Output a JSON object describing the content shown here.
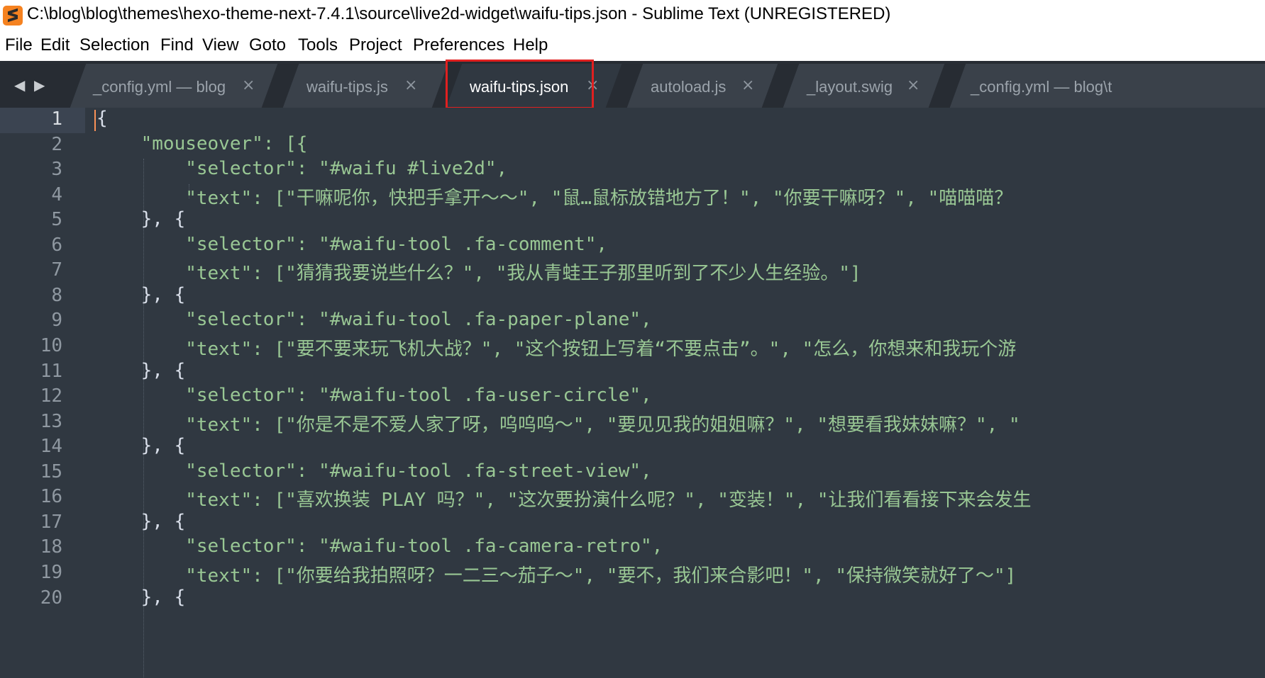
{
  "window": {
    "title": "C:\\blog\\blog\\themes\\hexo-theme-next-7.4.1\\source\\live2d-widget\\waifu-tips.json - Sublime Text (UNREGISTERED)"
  },
  "menu": [
    "File",
    "Edit",
    "Selection",
    "Find",
    "View",
    "Goto",
    "Tools",
    "Project",
    "Preferences",
    "Help"
  ],
  "tabs": [
    {
      "label": "_config.yml — blog",
      "close": "×",
      "active": false
    },
    {
      "label": "waifu-tips.js",
      "close": "×",
      "active": false
    },
    {
      "label": "waifu-tips.json",
      "close": "×",
      "active": true
    },
    {
      "label": "autoload.js",
      "close": "×",
      "active": false
    },
    {
      "label": "_layout.swig",
      "close": "×",
      "active": false
    },
    {
      "label": "_config.yml — blog\\t",
      "close": "",
      "active": false
    }
  ],
  "nav": {
    "back": "◀",
    "forward": "▶"
  },
  "editor": {
    "line_numbers": [
      "1",
      "2",
      "3",
      "4",
      "5",
      "6",
      "7",
      "8",
      "9",
      "10",
      "11",
      "12",
      "13",
      "14",
      "15",
      "16",
      "17",
      "18",
      "19",
      "20"
    ],
    "lines": [
      "{",
      "    \"mouseover\": [{",
      "        \"selector\": \"#waifu #live2d\",",
      "        \"text\": [\"干嘛呢你，快把手拿开～～\", \"鼠…鼠标放错地方了！\", \"你要干嘛呀？\", \"喵喵喵？",
      "    }, {",
      "        \"selector\": \"#waifu-tool .fa-comment\",",
      "        \"text\": [\"猜猜我要说些什么？\", \"我从青蛙王子那里听到了不少人生经验。\"]",
      "    }, {",
      "        \"selector\": \"#waifu-tool .fa-paper-plane\",",
      "        \"text\": [\"要不要来玩飞机大战？\", \"这个按钮上写着“不要点击”。\", \"怎么，你想来和我玩个游",
      "    }, {",
      "        \"selector\": \"#waifu-tool .fa-user-circle\",",
      "        \"text\": [\"你是不是不爱人家了呀，呜呜呜～\", \"要见见我的姐姐嘛？\", \"想要看我妹妹嘛？\", \"",
      "    }, {",
      "        \"selector\": \"#waifu-tool .fa-street-view\",",
      "        \"text\": [\"喜欢换装 PLAY 吗？\", \"这次要扮演什么呢？\", \"变装！\", \"让我们看看接下来会发生",
      "    }, {",
      "        \"selector\": \"#waifu-tool .fa-camera-retro\",",
      "        \"text\": [\"你要给我拍照呀？一二三～茄子～\", \"要不，我们来合影吧！\", \"保持微笑就好了～\"]",
      "    }, {"
    ]
  },
  "colors": {
    "editor_bg": "#303841",
    "tab_bar_bg": "#272c33",
    "string_green": "#99c794",
    "highlight_red": "#e02020"
  }
}
